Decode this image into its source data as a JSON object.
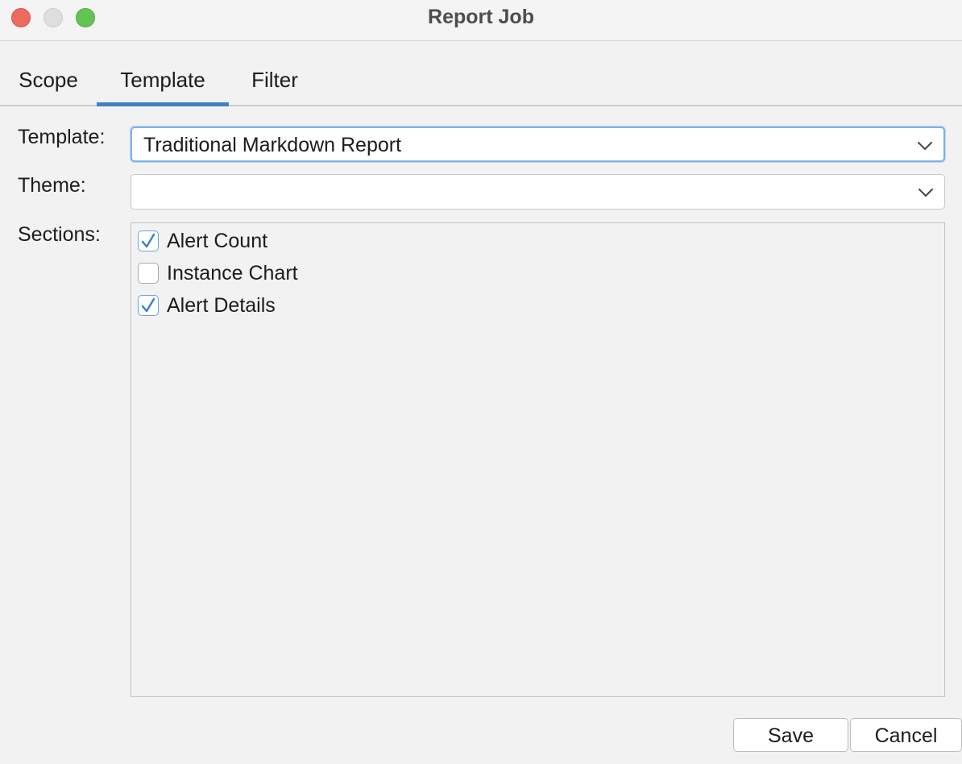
{
  "window": {
    "title": "Report Job"
  },
  "tabs": [
    {
      "label": "Scope",
      "active": false
    },
    {
      "label": "Template",
      "active": true
    },
    {
      "label": "Filter",
      "active": false
    }
  ],
  "form": {
    "template_label": "Template:",
    "template_value": "Traditional Markdown Report",
    "theme_label": "Theme:",
    "theme_value": "",
    "sections_label": "Sections:",
    "sections": [
      {
        "label": "Alert Count",
        "checked": true
      },
      {
        "label": "Instance Chart",
        "checked": false
      },
      {
        "label": "Alert Details",
        "checked": true
      }
    ]
  },
  "buttons": {
    "save_label": "Save",
    "cancel_label": "Cancel"
  },
  "colors": {
    "accent": "#3d7fc4",
    "close": "#ec6a5e",
    "minimize": "#dedede",
    "maximize": "#61c554"
  },
  "icons": {
    "dropdown": "chevron-down-icon",
    "check": "checkmark-icon"
  }
}
